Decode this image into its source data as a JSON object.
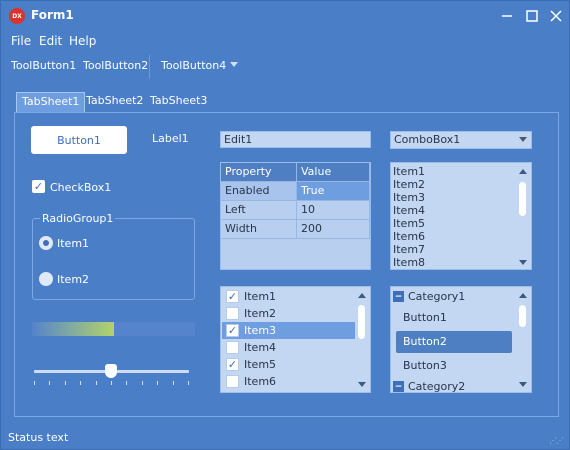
{
  "window": {
    "title": "Form1",
    "icon_text": "DX"
  },
  "menu": [
    "File",
    "Edit",
    "Help"
  ],
  "toolbar": [
    "ToolButton1",
    "ToolButton2",
    "ToolButton4"
  ],
  "tabs": [
    "TabSheet1",
    "TabSheet2",
    "TabSheet3"
  ],
  "button1": "Button1",
  "label1": "Label1",
  "edit1": "Edit1",
  "combobox": "ComboBox1",
  "checkbox": {
    "label": "CheckBox1",
    "checked": true
  },
  "radiogroup": {
    "title": "RadioGroup1",
    "items": [
      "Item1",
      "Item2"
    ],
    "selected": 0
  },
  "progress": 0.5,
  "slider": 0.5,
  "grid": {
    "headers": [
      "Property",
      "Value"
    ],
    "rows": [
      [
        "Enabled",
        "True"
      ],
      [
        "Left",
        "10"
      ],
      [
        "Width",
        "200"
      ]
    ]
  },
  "listbox": [
    "Item1",
    "Item2",
    "Item3",
    "Item4",
    "Item5",
    "Item6",
    "Item7",
    "Item8"
  ],
  "checklist": [
    {
      "label": "Item1",
      "checked": true
    },
    {
      "label": "Item2",
      "checked": false
    },
    {
      "label": "Item3",
      "checked": true
    },
    {
      "label": "Item4",
      "checked": false
    },
    {
      "label": "Item5",
      "checked": true
    },
    {
      "label": "Item6",
      "checked": false
    }
  ],
  "categories": {
    "cat1": "Category1",
    "buttons": [
      "Button1",
      "Button2",
      "Button3"
    ],
    "cat2": "Category2"
  },
  "status": "Status text",
  "colors": {
    "bg": "#4a7ec7",
    "accent": "#6e9de0",
    "field": "#c3d7f3"
  }
}
